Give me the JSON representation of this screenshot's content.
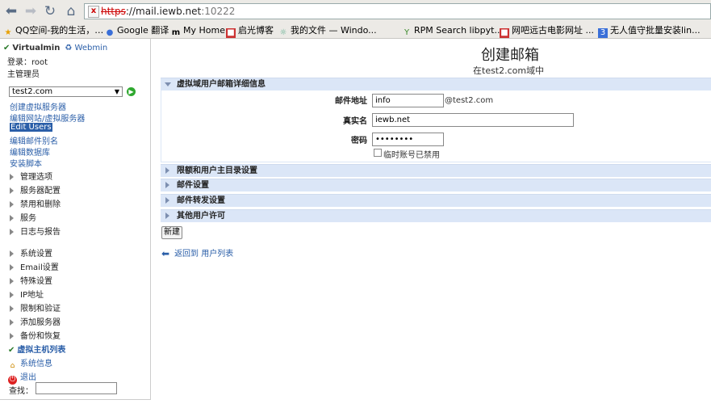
{
  "browser": {
    "url_scheme": "https",
    "url_host": "://mail.iewb.net",
    "url_port": ":10222",
    "bookmarks": [
      {
        "label": "QQ空间-我的生活，…",
        "icon": "star-icon"
      },
      {
        "label": "Google 翻译",
        "icon": "google-icon"
      },
      {
        "label": "My Home",
        "icon": "m-icon"
      },
      {
        "label": "启光博客",
        "icon": "blog-icon"
      },
      {
        "label": "我的文件 — Windo...",
        "icon": "files-icon"
      },
      {
        "label": "RPM Search libpyt...",
        "icon": "rpm-icon"
      },
      {
        "label": "网吧远古电影网址 ...",
        "icon": "film-icon"
      },
      {
        "label": "无人值守批量安装lin...",
        "icon": "install-icon"
      }
    ]
  },
  "sidebar": {
    "brand": "Virtualmin",
    "webmin": "Webmin",
    "login": "登录：root",
    "role": "主管理员",
    "domain": "test2.com",
    "links": [
      "创建虚拟服务器",
      "编辑网站/虚拟服务器",
      "Edit Users",
      "编辑邮件别名",
      "编辑数据库",
      "安装脚本"
    ],
    "menu_group1": [
      "管理选项",
      "服务器配置",
      "禁用和删除",
      "服务",
      "日志与报告"
    ],
    "menu_group2": [
      "系统设置",
      "Email设置",
      "特殊设置",
      "IP地址",
      "限制和验证",
      "添加服务器",
      "备份和恢复"
    ],
    "host_list": "虚拟主机列表",
    "system_info": "系统信息",
    "logout": "退出",
    "search_label": "查找："
  },
  "main": {
    "title": "创建邮箱",
    "subtitle": "在test2.com域中",
    "sections": [
      "虚拟域用户邮箱详细信息",
      "限额和用户主目录设置",
      "邮件设置",
      "邮件转发设置",
      "其他用户许可"
    ],
    "form": {
      "email_label": "邮件地址",
      "email_value": "info",
      "email_suffix": "@test2.com",
      "realname_label": "真实名",
      "realname_value": "iewb.net",
      "password_label": "密码",
      "password_value": "••••••••",
      "disable_label": "临时账号已禁用"
    },
    "create_button": "新建",
    "back_link": "返回到 用户列表"
  }
}
